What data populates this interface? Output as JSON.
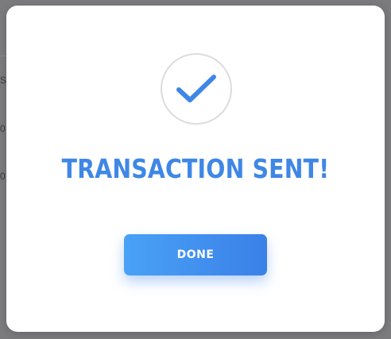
{
  "modal": {
    "title": "TRANSACTION SENT!",
    "done_label": "DONE",
    "icon": "checkmark-icon"
  },
  "background": {
    "fragments": [
      "Se",
      "0",
      "0"
    ]
  },
  "colors": {
    "accent": "#3f87e6",
    "button_gradient_start": "#49a2f5",
    "button_gradient_end": "#3a80e8",
    "overlay": "#747477",
    "modal_background": "#ffffff",
    "circle_border": "#dcdce0"
  }
}
